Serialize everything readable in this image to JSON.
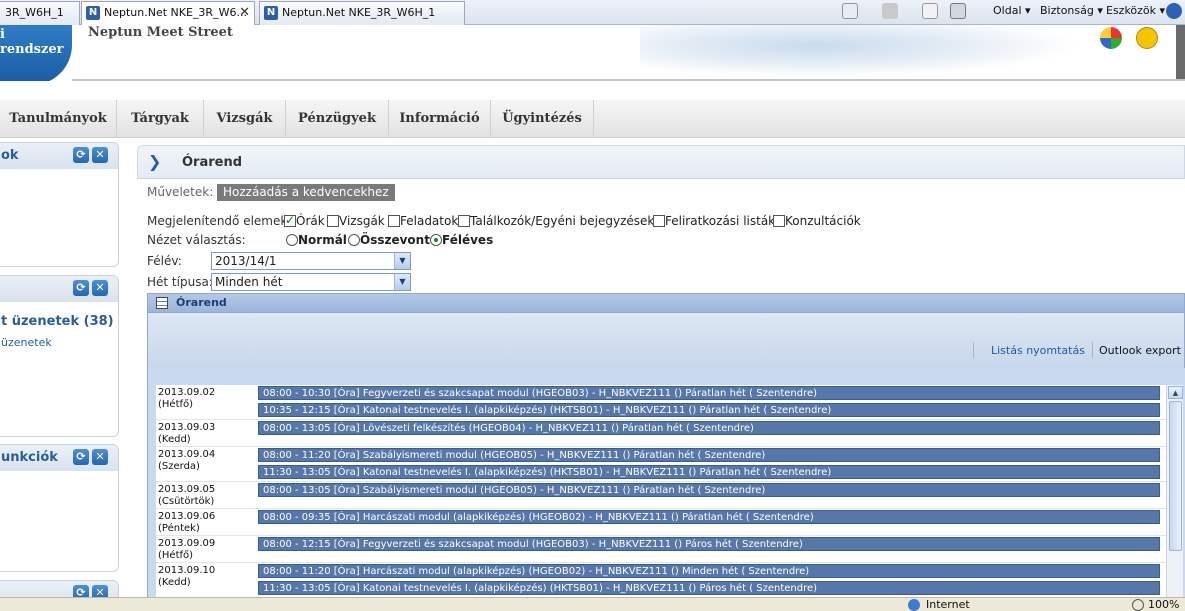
{
  "browser": {
    "tabs": [
      {
        "label": "3R_W6H_1"
      },
      {
        "label": "Neptun.Net NKE_3R_W6..."
      },
      {
        "label": "Neptun.Net NKE_3R_W6H_1"
      }
    ],
    "close_glyph": "✕",
    "command_bar": {
      "page_label": "Oldal",
      "safety_label": "Biztonság",
      "tools_label": "Eszközök",
      "dropdown_glyph": "▾"
    }
  },
  "header": {
    "logo_text": "i rendszer",
    "site_title": "Neptun Meet Street"
  },
  "nav": {
    "items": [
      {
        "label": "Tanulmányok"
      },
      {
        "label": "Tárgyak"
      },
      {
        "label": "Vizsgák"
      },
      {
        "label": "Pénzügyek"
      },
      {
        "label": "Információ"
      },
      {
        "label": "Ügyintézés"
      }
    ]
  },
  "sidebar": {
    "box1_title": "ok",
    "box2_title": "",
    "box2_link_main": "t üzenetek (38)",
    "box2_link_sub": "üzenetek",
    "box3_title": "unkciók",
    "refresh_glyph": "⟳",
    "close_glyph": "✕"
  },
  "page": {
    "title": "Órarend",
    "actions_label": "Műveletek:",
    "add_favorite": "Hozzáadás a kedvencekhez",
    "show_items_label": "Megjelenítendő elemek:",
    "show_items": [
      {
        "label": "Órák",
        "checked": true
      },
      {
        "label": "Vizsgák",
        "checked": false
      },
      {
        "label": "Feladatok",
        "checked": false
      },
      {
        "label": "Találkozók/Egyéni bejegyzések",
        "checked": false
      },
      {
        "label": "Feliratkozási listák",
        "checked": false
      },
      {
        "label": "Konzultációk",
        "checked": false
      }
    ],
    "view_label": "Nézet választás:",
    "views": [
      {
        "label": "Normál",
        "checked": false
      },
      {
        "label": "Összevont",
        "checked": false
      },
      {
        "label": "Féléves",
        "checked": true
      }
    ],
    "semester_label": "Félév:",
    "semester_value": "2013/14/1",
    "week_type_label": "Hét típusa:",
    "week_type_value": "Minden hét"
  },
  "timetable": {
    "title": "Órarend",
    "print_link": "Listás nyomtatás",
    "outlook_link": "Outlook export",
    "days": [
      {
        "date": "2013.09.02",
        "weekday": "(Hétfő)",
        "events": [
          "08:00 - 10:30 [Óra] Fegyverzeti és szakcsapat modul (HGEOB03) - H_NBKVEZ111 () Páratlan hét ( Szentendre)",
          "10:35 - 12:15 [Óra] Katonai testnevelés I. (alapkiképzés) (HKTSB01) - H_NBKVEZ111 () Páratlan hét ( Szentendre)"
        ]
      },
      {
        "date": "2013.09.03",
        "weekday": "(Kedd)",
        "events": [
          "08:00 - 13:05 [Óra] Lövészeti felkészítés (HGEOB04) - H_NBKVEZ111 () Páratlan hét ( Szentendre)"
        ]
      },
      {
        "date": "2013.09.04",
        "weekday": "(Szerda)",
        "events": [
          "08:00 - 11:20 [Óra] Szabályismereti modul (HGEOB05) - H_NBKVEZ111 () Páratlan hét ( Szentendre)",
          "11:30 - 13:05 [Óra] Katonai testnevelés I. (alapkiképzés) (HKTSB01) - H_NBKVEZ111 () Páratlan hét ( Szentendre)"
        ]
      },
      {
        "date": "2013.09.05",
        "weekday": "(Csütörtök)",
        "events": [
          "08:00 - 13:05 [Óra] Szabályismereti modul (HGEOB05) - H_NBKVEZ111 () Páratlan hét ( Szentendre)"
        ]
      },
      {
        "date": "2013.09.06",
        "weekday": "(Péntek)",
        "events": [
          "08:00 - 09:35 [Óra] Harcászati modul (alapkiképzés) (HGEOB02) - H_NBKVEZ111 () Páratlan hét ( Szentendre)"
        ]
      },
      {
        "date": "2013.09.09",
        "weekday": "(Hétfő)",
        "events": [
          "08:00 - 12:15 [Óra] Fegyverzeti és szakcsapat modul (HGEOB03) - H_NBKVEZ111 () Páros hét ( Szentendre)"
        ]
      },
      {
        "date": "2013.09.10",
        "weekday": "(Kedd)",
        "events": [
          "08:00 - 11:20 [Óra] Harcászati modul (alapkiképzés) (HGEOB02) - H_NBKVEZ111 () Minden hét ( Szentendre)",
          "11:30 - 13:05 [Óra] Katonai testnevelés I. (alapkiképzés) (HKTSB01) - H_NBKVEZ111 () Páros hét ( Szentendre)"
        ]
      }
    ]
  },
  "statusbar": {
    "zone": "Internet",
    "zoom": "100%"
  },
  "colors": {
    "event_bg": "#5577aa",
    "accent": "#2a5d99"
  }
}
